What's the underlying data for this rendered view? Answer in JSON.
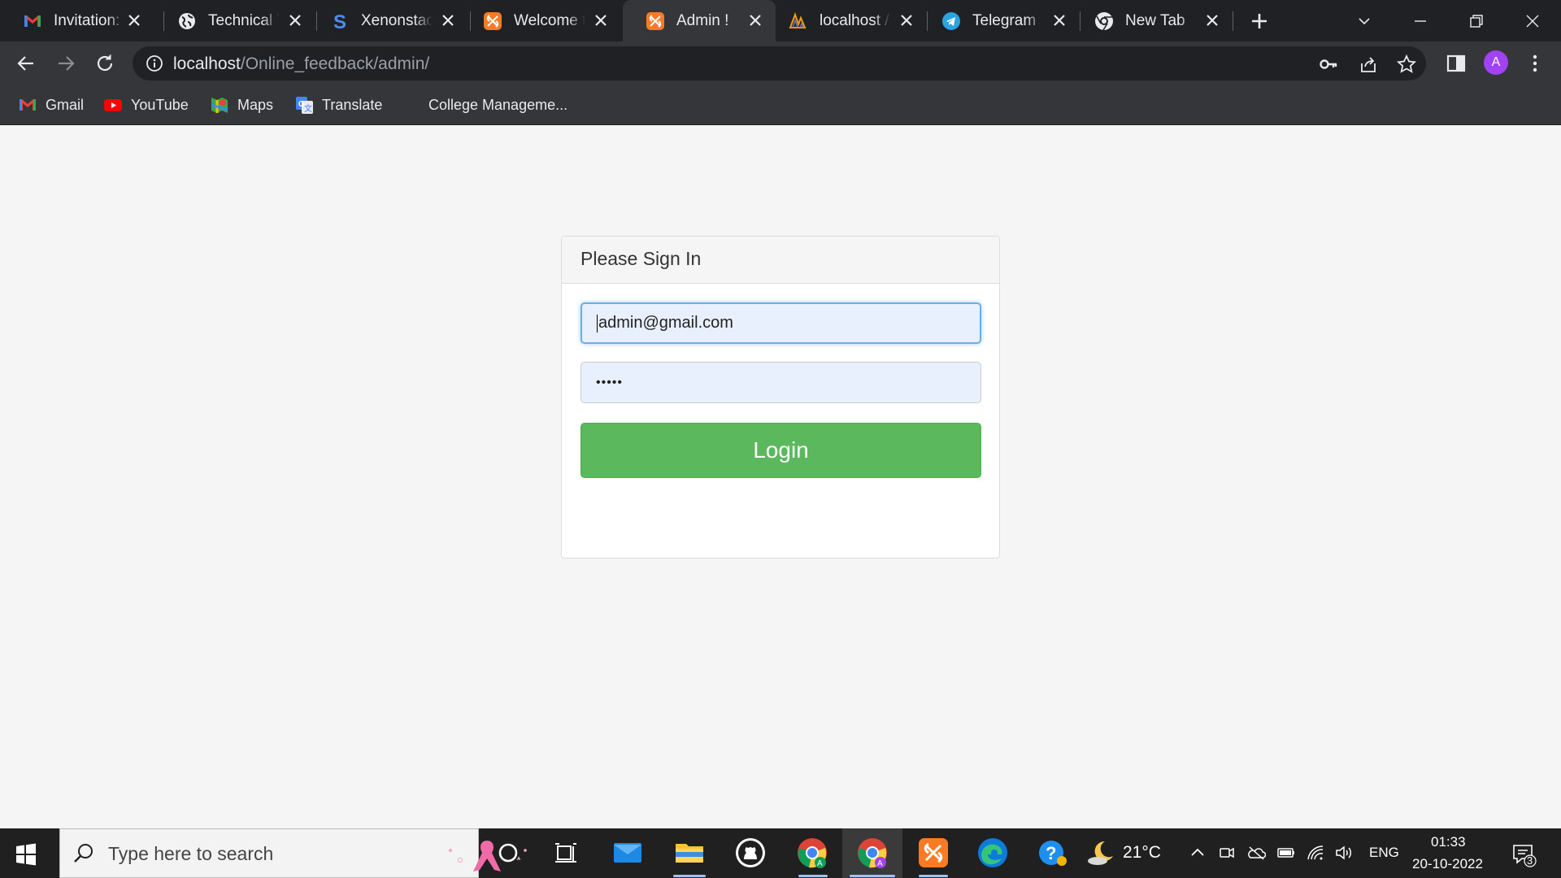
{
  "browser": {
    "tabs": [
      {
        "title": "Invitation: T",
        "icon": "gmail-icon"
      },
      {
        "title": "Technical Ta",
        "icon": "globe-icon"
      },
      {
        "title": "Xenonstack",
        "icon": "s-logo-icon"
      },
      {
        "title": "Welcome to",
        "icon": "xampp-icon"
      },
      {
        "title": "Admin !",
        "icon": "xampp-icon"
      },
      {
        "title": "localhost /",
        "icon": "phpmyadmin-icon"
      },
      {
        "title": "Telegram",
        "icon": "telegram-icon"
      },
      {
        "title": "New Tab",
        "icon": "chrome-icon"
      }
    ],
    "active_tab_index": 4,
    "address": {
      "host": "localhost",
      "path": "/Online_feedback/admin/"
    },
    "profile_initial": "A",
    "profile_color": "#a142f4",
    "bookmarks": [
      {
        "label": "Gmail",
        "icon": "gmail-icon"
      },
      {
        "label": "YouTube",
        "icon": "youtube-icon"
      },
      {
        "label": "Maps",
        "icon": "maps-icon"
      },
      {
        "label": "Translate",
        "icon": "translate-icon"
      },
      {
        "label": "College Manageme...",
        "icon": ""
      }
    ]
  },
  "login": {
    "heading": "Please Sign In",
    "email_value": "admin@gmail.com",
    "password_mask": "•••••",
    "button_label": "Login",
    "button_color": "#5cb85c"
  },
  "taskbar": {
    "search_placeholder": "Type here to search",
    "weather_temp": "21°C",
    "language": "ENG",
    "time": "01:33",
    "date": "20-10-2022",
    "notification_count": "3"
  }
}
